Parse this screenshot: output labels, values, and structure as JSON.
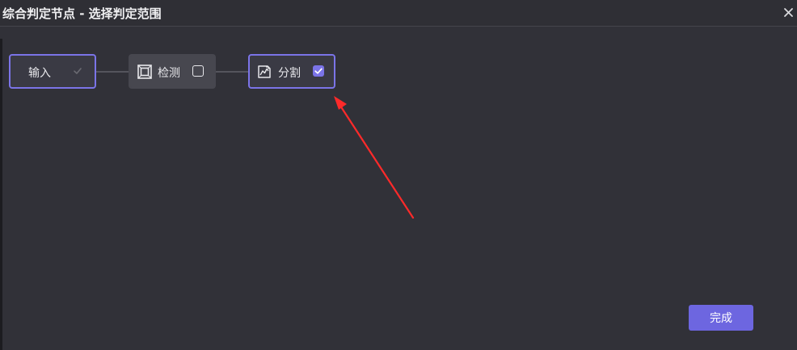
{
  "dialog": {
    "title": "综合判定节点 - 选择判定范围",
    "close_icon": "close-icon"
  },
  "nodes": [
    {
      "label": "输入",
      "checked": true,
      "disabled": true,
      "selected": true,
      "icon": ""
    },
    {
      "label": "检测",
      "checked": false,
      "disabled": false,
      "selected": false,
      "icon": "bounding-box-icon"
    },
    {
      "label": "分割",
      "checked": true,
      "disabled": false,
      "selected": true,
      "icon": "segmentation-icon"
    }
  ],
  "footer": {
    "done_label": "完成"
  },
  "colors": {
    "accent": "#7b74e8",
    "button": "#6d66e0",
    "background": "#313138",
    "annotation_arrow": "#ff2a2a"
  }
}
